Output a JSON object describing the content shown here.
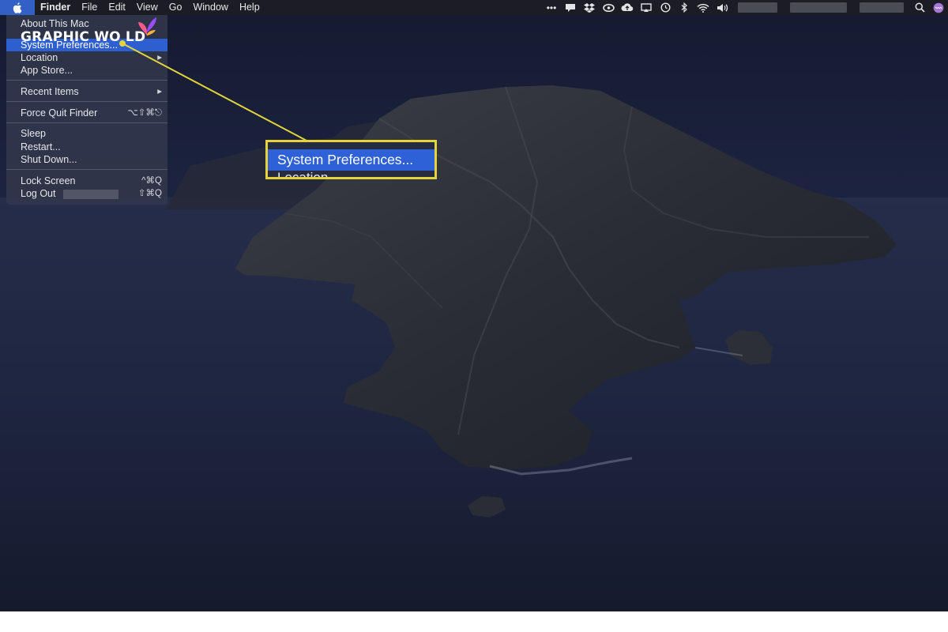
{
  "menubar": {
    "app_name": "Finder",
    "menus": [
      "File",
      "Edit",
      "View",
      "Go",
      "Window",
      "Help"
    ],
    "status_icons": [
      "more-dots-icon",
      "notifications-icon",
      "dropbox-icon",
      "creative-cloud-icon",
      "cloud-upload-icon",
      "airplay-icon",
      "time-machine-icon",
      "bluetooth-icon",
      "wifi-icon",
      "volume-icon"
    ],
    "search_icon": "search-icon"
  },
  "apple_menu": {
    "items": [
      {
        "label": "About This Mac",
        "shortcut": ""
      },
      {
        "label": "System Preferences...",
        "shortcut": ""
      },
      {
        "label": "Location",
        "shortcut": "▸"
      },
      {
        "label": "App Store...",
        "shortcut": ""
      },
      {
        "label": "Recent Items",
        "shortcut": "▸"
      },
      {
        "label": "Force Quit Finder",
        "shortcut": "⌥⇧⌘⎋"
      },
      {
        "label": "Sleep",
        "shortcut": ""
      },
      {
        "label": "Restart...",
        "shortcut": ""
      },
      {
        "label": "Shut Down...",
        "shortcut": ""
      },
      {
        "label": "Lock Screen",
        "shortcut": "^⌘Q"
      },
      {
        "label": "Log Out",
        "shortcut": "⇧⌘Q"
      }
    ],
    "highlighted_index": 1
  },
  "watermark": {
    "text": "GRAPHIC WO LD"
  },
  "callout": {
    "highlight_label": "System Preferences...",
    "next_label": "Location",
    "border_color": "#e3d43c"
  },
  "colors": {
    "selection": "#2e61d6",
    "menubar": "#1c1d24"
  }
}
